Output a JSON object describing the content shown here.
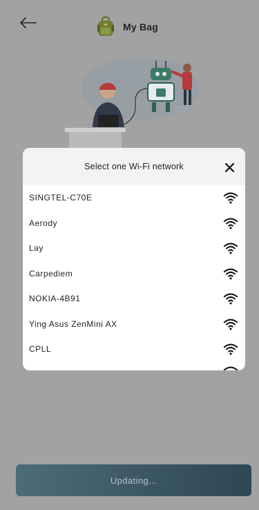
{
  "header": {
    "title": "My Bag",
    "back_icon": "arrow-left-icon",
    "bag_icon": "backpack-icon"
  },
  "dialog": {
    "title": "Select one Wi-Fi network",
    "close_icon": "close-icon",
    "networks": [
      {
        "name": "SINGTEL-C70E",
        "icon": "wifi-icon"
      },
      {
        "name": "Aerody",
        "icon": "wifi-icon"
      },
      {
        "name": "Lay",
        "icon": "wifi-icon"
      },
      {
        "name": "Carpediem",
        "icon": "wifi-icon"
      },
      {
        "name": "NOKIA-4B91",
        "icon": "wifi-icon"
      },
      {
        "name": "Ying Asus ZenMini AX",
        "icon": "wifi-icon"
      },
      {
        "name": "CPLL",
        "icon": "wifi-icon"
      }
    ]
  },
  "footer": {
    "button_label": "Updating..."
  },
  "colors": {
    "overlay_bg": "#a2a2a2",
    "button_bg": "#3a5562",
    "button_text": "#b7c3c8"
  }
}
